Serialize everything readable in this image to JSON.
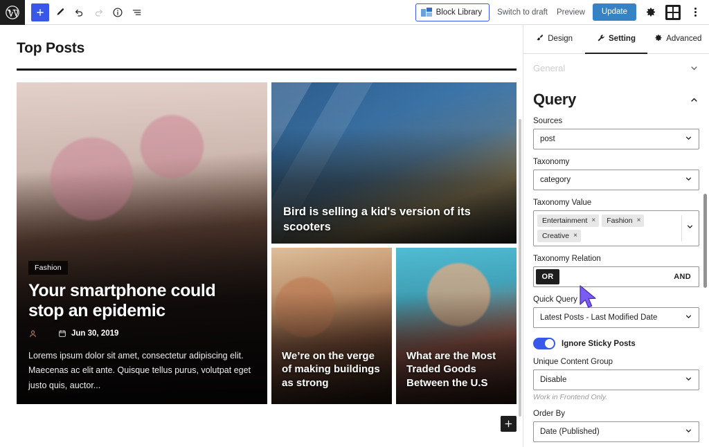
{
  "topbar": {
    "logo_icon": "wordpress-logo-icon",
    "add_block_icon": "plus-icon",
    "edit_icon": "pencil-icon",
    "undo_icon": "undo-arrow-icon",
    "redo_icon": "redo-arrow-icon",
    "info_icon": "info-circle-icon",
    "list_view_icon": "list-view-icon",
    "block_library_label": "Block Library",
    "block_library_icon": "blocks-icon",
    "switch_to_draft_label": "Switch to draft",
    "preview_label": "Preview",
    "update_label": "Update",
    "settings_icon": "gear-icon",
    "blocks_panel_icon": "blocks-grid-icon",
    "more_options_icon": "kebab-menu-icon"
  },
  "canvas": {
    "page_title": "Top Posts",
    "appender_icon": "plus-icon",
    "posts": [
      {
        "category": "Fashion",
        "title": "Your smartphone could stop an epidemic",
        "author_icon": "user-icon",
        "date_icon": "calendar-icon",
        "date": "Jun 30, 2019",
        "excerpt": "Lorems ipsum dolor sit amet, consectetur adipiscing elit. Maecenas ac elit ante. Quisque tellus purus, volutpat eget justo quis, auctor..."
      },
      {
        "title": "Bird is selling a kid's version of its scooters"
      },
      {
        "title": "We’re on the verge of making buildings as strong"
      },
      {
        "title": "What are the Most Traded Goods Between the U.S"
      }
    ]
  },
  "sidebar": {
    "tabs": [
      {
        "label": "Design",
        "icon": "brush-icon",
        "active": false
      },
      {
        "label": "Setting",
        "icon": "wrench-icon",
        "active": true
      },
      {
        "label": "Advanced",
        "icon": "gear-icon",
        "active": false
      }
    ],
    "sections": [
      {
        "label": "General",
        "expanded": false,
        "chevron": "chevron-down-icon"
      },
      {
        "label": "Query",
        "expanded": true,
        "chevron": "chevron-up-icon"
      }
    ],
    "fields": {
      "sources_label": "Sources",
      "sources_value": "post",
      "taxonomy_label": "Taxonomy",
      "taxonomy_value": "category",
      "taxonomy_value_label": "Taxonomy Value",
      "taxonomy_tokens": [
        "Entertainment",
        "Fashion",
        "Creative"
      ],
      "token_remove_glyph": "×",
      "taxonomy_relation_label": "Taxonomy Relation",
      "relation_or": "OR",
      "relation_and": "AND",
      "relation_selected": "OR",
      "quick_query_label": "Quick Query",
      "quick_query_value": "Latest Posts - Last Modified Date",
      "ignore_sticky_label": "Ignore Sticky Posts",
      "ignore_sticky_on": true,
      "unique_group_label": "Unique Content Group",
      "unique_group_value": "Disable",
      "unique_group_help": "Work in Frontend Only.",
      "order_by_label": "Order By",
      "order_by_value": "Date (Published)"
    }
  },
  "colors": {
    "wp_blue": "#3858e9",
    "update_blue": "#3582c4",
    "toggle_on": "#3858e9",
    "dark": "#1e1e1e",
    "cursor": "#7b5cf0"
  }
}
